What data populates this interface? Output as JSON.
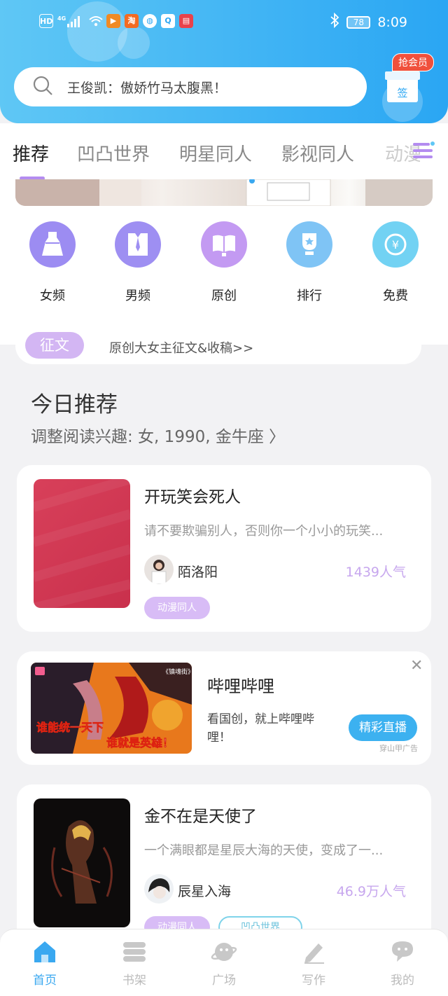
{
  "status_bar": {
    "left_icons": [
      "HD",
      "4G",
      "signal",
      "wifi",
      "video-app",
      "taobao",
      "browser",
      "search-app",
      "book-app"
    ],
    "battery": "78",
    "time": "8:09"
  },
  "header": {
    "search_placeholder": "王俊凯：傲娇竹马太腹黑！",
    "vip_badge": "抢会员",
    "gift_label": "签"
  },
  "tabs": [
    {
      "label": "推荐",
      "active": true
    },
    {
      "label": "凹凸世界",
      "active": false
    },
    {
      "label": "明星同人",
      "active": false
    },
    {
      "label": "影视同人",
      "active": false
    },
    {
      "label": "动漫",
      "active": false
    }
  ],
  "categories": [
    {
      "label": "女频",
      "icon": "dress-icon",
      "color": "#9c8cf2"
    },
    {
      "label": "男频",
      "icon": "shirt-tie-icon",
      "color": "#9e8ff2"
    },
    {
      "label": "原创",
      "icon": "open-book-icon",
      "color": "#c39af2"
    },
    {
      "label": "排行",
      "icon": "trophy-icon",
      "color": "#7fc4f5"
    },
    {
      "label": "免费",
      "icon": "yuan-coin-icon",
      "color": "#72d2f3"
    }
  ],
  "contest": {
    "badge": "征文",
    "text": "原创大女主征文&收稿>>"
  },
  "today": {
    "title": "今日推荐",
    "subtitle": "调整阅读兴趣: 女, 1990, 金牛座 〉"
  },
  "books": [
    {
      "title": "开玩笑会死人",
      "desc": "请不要欺骗别人，否则你一个小小的玩笑...",
      "author": "陌洛阳",
      "popularity": "1439人气",
      "tags": [
        "动漫同人"
      ]
    },
    {
      "title": "金不在是天使了",
      "desc": "一个满眼都是星辰大海的天使，变成了一...",
      "author": "辰星入海",
      "popularity": "46.9万人气",
      "tags": [
        "动漫同人",
        "凹凸世界"
      ]
    }
  ],
  "ad": {
    "title": "哔哩哔哩",
    "desc": "看国创，就上哔哩哔哩！",
    "button": "精彩直播",
    "source": "穿山甲广告",
    "image_caption_line1": "谁能统一天下",
    "image_caption_line2": "谁就是英雄！",
    "image_tag": "《镇魂街》"
  },
  "bottom_nav": [
    {
      "label": "首页",
      "icon": "home-icon",
      "active": true
    },
    {
      "label": "书架",
      "icon": "bookshelf-icon",
      "active": false
    },
    {
      "label": "广场",
      "icon": "planet-icon",
      "active": false
    },
    {
      "label": "写作",
      "icon": "pen-icon",
      "active": false
    },
    {
      "label": "我的",
      "icon": "chat-bubble-icon",
      "active": false
    }
  ]
}
